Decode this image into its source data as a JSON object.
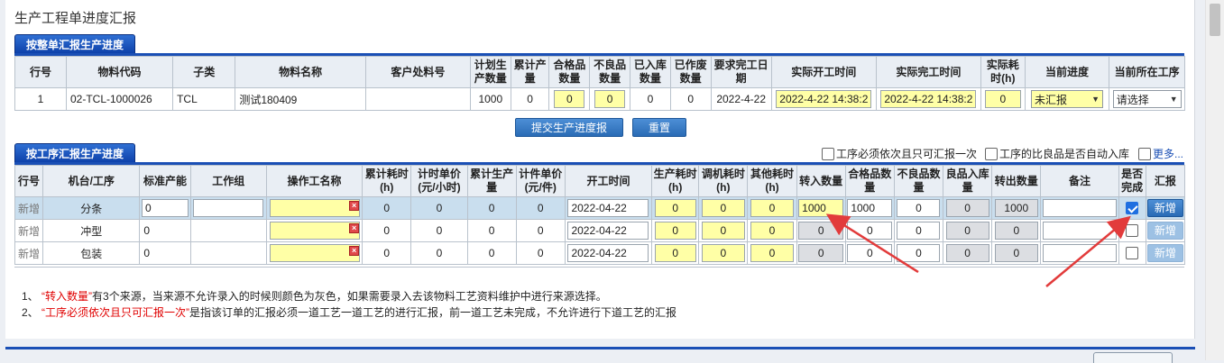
{
  "page": {
    "title": "生产工程单进度汇报"
  },
  "order_section": {
    "tab_label": "按整单汇报生产进度",
    "headers": [
      "行号",
      "物料代码",
      "子类",
      "物料名称",
      "客户处料号",
      "计划生产数量",
      "累计产量",
      "合格品数量",
      "不良品数量",
      "已入库数量",
      "已作废数量",
      "要求完工日期",
      "实际开工时间",
      "实际完工时间",
      "实际耗时(h)",
      "当前进度",
      "当前所在工序"
    ],
    "row": {
      "line_no": "1",
      "material_code": "02-TCL-1000026",
      "subclass": "TCL",
      "material_name": "测试180409",
      "customer_part": "",
      "planned_qty": "1000",
      "cumulative_qty": "0",
      "qualified_qty": "0",
      "defect_qty": "0",
      "stocked_qty": "0",
      "scrapped_qty": "0",
      "due_date": "2022-4-22",
      "actual_start": "2022-4-22 14:38:2",
      "actual_finish": "2022-4-22 14:38:2",
      "actual_hours": "0",
      "progress": "未汇报",
      "current_process": "请选择"
    },
    "submit_label": "提交生产进度报告",
    "reset_label": "重置"
  },
  "process_section": {
    "tab_label": "按工序汇报生产进度",
    "options": {
      "sequential_label": "工序必须依次且只可汇报一次",
      "auto_stock_label": "工序的比良品是否自动入库",
      "more_label": "更多..."
    },
    "headers": [
      "行号",
      "机台/工序",
      "标准产能",
      "工作组",
      "操作工名称",
      "累计耗时(h)",
      "计时单价(元/小时)",
      "累计生产量",
      "计件单价(元/件)",
      "开工时间",
      "生产耗时(h)",
      "调机耗时(h)",
      "其他耗时(h)",
      "转入数量",
      "合格品数量",
      "不良品数量",
      "良品入库量",
      "转出数量",
      "备注",
      "是否完成",
      "汇报"
    ],
    "rows": [
      {
        "line_no": "新增",
        "process": "分条",
        "std_capacity": "0",
        "work_group": "",
        "operator": "",
        "cum_hours": "0",
        "hourly_price": "0",
        "cum_output": "0",
        "piece_price": "0",
        "start_time": "2022-04-22",
        "prod_hours": "0",
        "setup_hours": "0",
        "other_hours": "0",
        "transfer_in": "1000",
        "qualified": "1000",
        "defect": "0",
        "good_stocked": "0",
        "transfer_out": "1000",
        "remark": "",
        "done": true,
        "action": "新增"
      },
      {
        "line_no": "新增",
        "process": "冲型",
        "std_capacity": "0",
        "work_group": "",
        "operator": "",
        "cum_hours": "0",
        "hourly_price": "0",
        "cum_output": "0",
        "piece_price": "0",
        "start_time": "2022-04-22",
        "prod_hours": "0",
        "setup_hours": "0",
        "other_hours": "0",
        "transfer_in": "0",
        "qualified": "0",
        "defect": "0",
        "good_stocked": "0",
        "transfer_out": "0",
        "remark": "",
        "done": false,
        "action": "新增"
      },
      {
        "line_no": "新增",
        "process": "包装",
        "std_capacity": "0",
        "work_group": "",
        "operator": "",
        "cum_hours": "0",
        "hourly_price": "0",
        "cum_output": "0",
        "piece_price": "0",
        "start_time": "2022-04-22",
        "prod_hours": "0",
        "setup_hours": "0",
        "other_hours": "0",
        "transfer_in": "0",
        "qualified": "0",
        "defect": "0",
        "good_stocked": "0",
        "transfer_out": "0",
        "remark": "",
        "done": false,
        "action": "新增"
      }
    ]
  },
  "notes": [
    {
      "num": "1、",
      "quote": "“转入数量”",
      "text": "有3个来源，当来源不允许录入的时候则颜色为灰色，如果需要录入去该物料工艺资料维护中进行来源选择。"
    },
    {
      "num": "2、",
      "quote": "“工序必须依次且只可汇报一次”",
      "text": "是指该订单的汇报必须一道工艺一道工艺的进行汇报，前一道工艺未完成，不允许进行下道工艺的汇报"
    }
  ],
  "colors": {
    "tab_blue": "#1a4fb5",
    "input_yellow": "#ffffa6",
    "highlight_row": "#c9deee",
    "arrow_red": "#e23b3b",
    "note_red": "#e00000"
  }
}
